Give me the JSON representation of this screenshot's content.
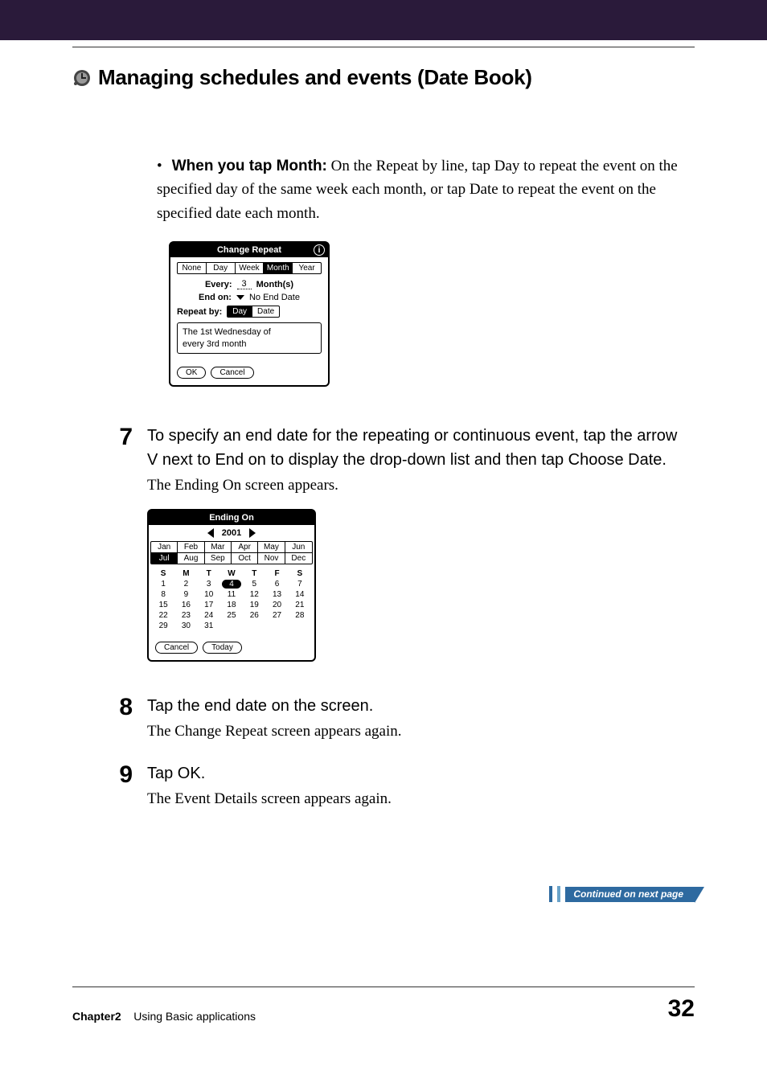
{
  "header": {
    "title": "Managing schedules and events (Date Book)"
  },
  "bullet": {
    "prefix": "•",
    "bold": "When you tap Month:",
    "rest": " On the Repeat by line, tap Day to repeat the event on the specified day of the same week each month, or tap Date to repeat the event on the specified date each month."
  },
  "change_repeat": {
    "title": "Change Repeat",
    "tabs": [
      "None",
      "Day",
      "Week",
      "Month",
      "Year"
    ],
    "selected_tab": "Month",
    "every_label": "Every:",
    "every_value": "3",
    "every_unit": "Month(s)",
    "endon_label": "End on:",
    "endon_value": "No End Date",
    "repeatby_label": "Repeat by:",
    "repeatby_options": [
      "Day",
      "Date"
    ],
    "repeatby_selected": "Day",
    "readout_line1": "The 1st Wednesday of",
    "readout_line2": "every 3rd month",
    "ok": "OK",
    "cancel": "Cancel"
  },
  "step7": {
    "num": "7",
    "title_a": "To specify an end date for the repeating or continuous event, tap the arrow ",
    "arrow": "V",
    "title_b": " next to End on to display the drop-down list and then tap Choose Date.",
    "sub": "The Ending On screen appears."
  },
  "ending_on": {
    "title": "Ending On",
    "year": "2001",
    "months": [
      "Jan",
      "Feb",
      "Mar",
      "Apr",
      "May",
      "Jun",
      "Jul",
      "Aug",
      "Sep",
      "Oct",
      "Nov",
      "Dec"
    ],
    "month_selected": "Jul",
    "weekdays": [
      "S",
      "M",
      "T",
      "W",
      "T",
      "F",
      "S"
    ],
    "days": [
      [
        "1",
        "2",
        "3",
        "4",
        "5",
        "6",
        "7"
      ],
      [
        "8",
        "9",
        "10",
        "11",
        "12",
        "13",
        "14"
      ],
      [
        "15",
        "16",
        "17",
        "18",
        "19",
        "20",
        "21"
      ],
      [
        "22",
        "23",
        "24",
        "25",
        "26",
        "27",
        "28"
      ],
      [
        "29",
        "30",
        "31",
        "",
        "",
        "",
        ""
      ]
    ],
    "today_value": "4",
    "cancel": "Cancel",
    "today": "Today"
  },
  "step8": {
    "num": "8",
    "title": "Tap the end date on the screen.",
    "sub": "The Change Repeat screen appears again."
  },
  "step9": {
    "num": "9",
    "title": "Tap OK.",
    "sub": "The Event Details screen appears again."
  },
  "continued": {
    "label": "Continued on next page"
  },
  "footer": {
    "chapter_label": "Chapter2",
    "chapter_text": "Using Basic applications",
    "page": "32"
  }
}
